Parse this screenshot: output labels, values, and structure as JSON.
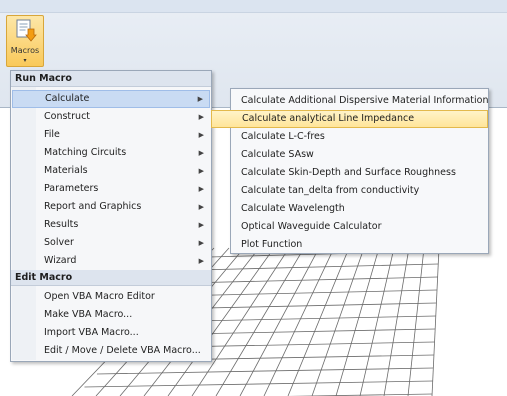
{
  "ribbon": {
    "macros_label": "Macros",
    "macros_arrow": "▾"
  },
  "menu": {
    "run_header": "Run Macro",
    "run_items": [
      {
        "label": "Calculate",
        "has_submenu": true,
        "active": true
      },
      {
        "label": "Construct",
        "has_submenu": true
      },
      {
        "label": "File",
        "has_submenu": true
      },
      {
        "label": "Matching Circuits",
        "has_submenu": true
      },
      {
        "label": "Materials",
        "has_submenu": true
      },
      {
        "label": "Parameters",
        "has_submenu": true
      },
      {
        "label": "Report and Graphics",
        "has_submenu": true
      },
      {
        "label": "Results",
        "has_submenu": true
      },
      {
        "label": "Solver",
        "has_submenu": true
      },
      {
        "label": "Wizard",
        "has_submenu": true
      }
    ],
    "edit_header": "Edit Macro",
    "edit_items": [
      {
        "label": "Open VBA Macro Editor"
      },
      {
        "label": "Make VBA Macro..."
      },
      {
        "label": "Import VBA Macro..."
      },
      {
        "label": "Edit / Move / Delete VBA Macro..."
      }
    ],
    "arrow_glyph": "▶"
  },
  "submenu": {
    "items": [
      {
        "label": "Calculate Additional Dispersive Material Information"
      },
      {
        "label": "Calculate analytical Line Impedance",
        "hover": true
      },
      {
        "label": "Calculate L-C-fres"
      },
      {
        "label": "Calculate SAsw"
      },
      {
        "label": "Calculate Skin-Depth and Surface Roughness"
      },
      {
        "label": "Calculate tan_delta from conductivity"
      },
      {
        "label": "Calculate Wavelength"
      },
      {
        "label": "Optical Waveguide Calculator"
      },
      {
        "label": "Plot Function"
      }
    ]
  },
  "colors": {
    "grid_line": "#6b6b6b",
    "hover_fill": "#ffe59a",
    "active_fill": "#c9dbf3"
  }
}
